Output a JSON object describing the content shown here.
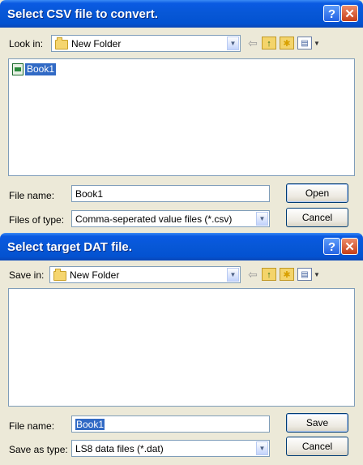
{
  "open_dialog": {
    "title": "Select CSV file to convert.",
    "help_label": "?",
    "close_label": "✕",
    "look_in_label": "Look in:",
    "look_in_value": "New Folder",
    "files": [
      {
        "name": "Book1"
      }
    ],
    "file_name_label": "File name:",
    "file_name_value": "Book1",
    "file_type_label": "Files of type:",
    "file_type_value": "Comma-seperated value files (*.csv)",
    "open_label": "Open",
    "cancel_label": "Cancel"
  },
  "save_dialog": {
    "title": "Select target DAT file.",
    "help_label": "?",
    "close_label": "✕",
    "save_in_label": "Save in:",
    "save_in_value": "New Folder",
    "file_name_label": "File name:",
    "file_name_value": "Book1",
    "save_type_label": "Save as type:",
    "save_type_value": "LS8 data files (*.dat)",
    "save_label": "Save",
    "cancel_label": "Cancel"
  },
  "icons": {
    "back": "back-arrow-icon",
    "up": "up-folder-icon",
    "new_folder": "new-folder-icon",
    "view_menu": "view-menu-icon",
    "combo_arrow": "dropdown-arrow-icon"
  },
  "colors": {
    "titlebar": "#0757d6",
    "dialog_bg": "#ece9d8",
    "selection": "#316ac5",
    "close_button": "#c63f18"
  }
}
